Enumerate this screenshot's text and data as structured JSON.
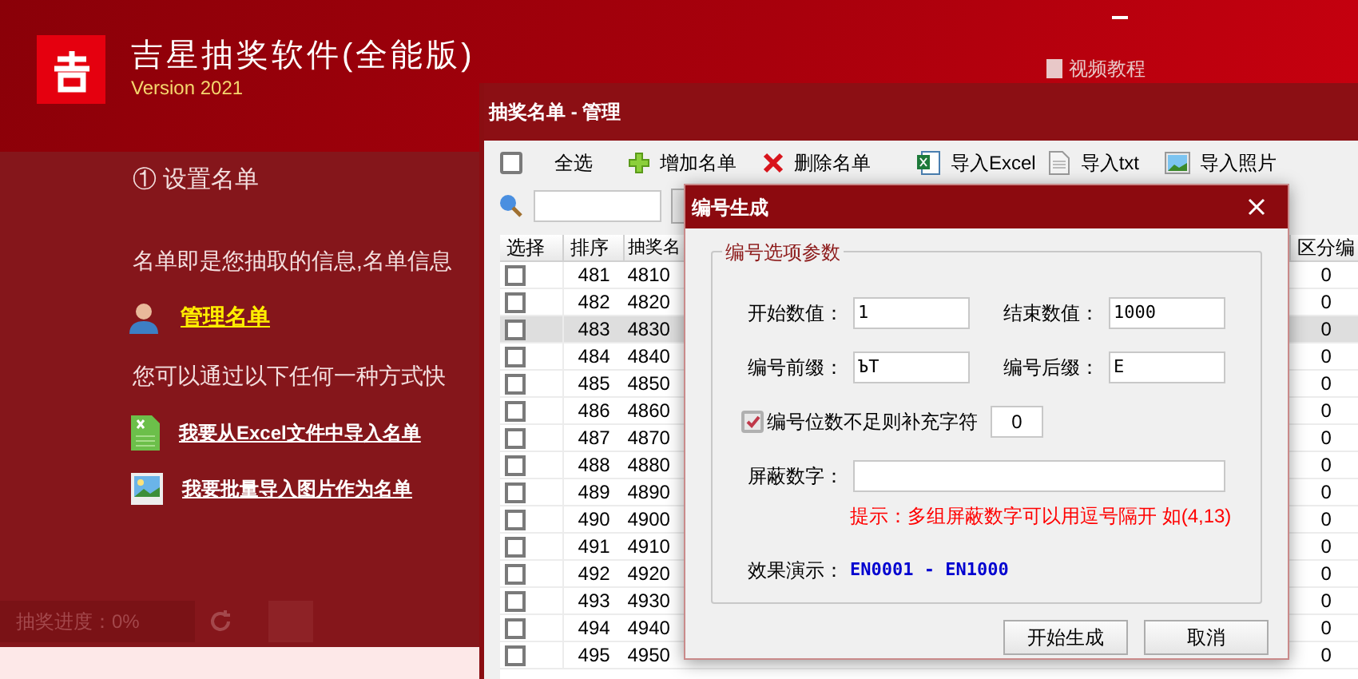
{
  "app": {
    "title": "吉星抽奖软件(全能版)",
    "version": "Version 2021",
    "video_link": "视频教程",
    "section_title": "① 设置名单",
    "description": "名单即是您抽取的信息,名单信息",
    "manage_link": "管理名单",
    "methods_text": "您可以通过以下任何一种方式快",
    "import_links": [
      {
        "kind": "excel",
        "label": "我要从Excel文件中导入名单"
      },
      {
        "kind": "image",
        "label": "我要批量导入图片作为名单"
      }
    ],
    "progress": {
      "text": "抽奖进度：0%",
      "level": 0
    }
  },
  "manager": {
    "title": "抽奖名单 - 管理",
    "select_all": {
      "label": "全选",
      "checked": false
    },
    "toolbar": [
      {
        "kind": "add",
        "label": "增加名单"
      },
      {
        "kind": "delete",
        "label": "删除名单"
      },
      {
        "kind": "excel",
        "label": "导入Excel"
      },
      {
        "kind": "txt",
        "label": "导入txt"
      },
      {
        "kind": "photo",
        "label": "导入照片"
      }
    ],
    "columns": [
      "选择",
      "排序",
      "抽奖名",
      "区分编"
    ],
    "rows": [
      {
        "checked": false,
        "selected": false,
        "order": "481",
        "name": "4810",
        "group": "0"
      },
      {
        "checked": false,
        "selected": false,
        "order": "482",
        "name": "4820",
        "group": "0"
      },
      {
        "checked": false,
        "selected": true,
        "order": "483",
        "name": "4830",
        "group": "0"
      },
      {
        "checked": false,
        "selected": false,
        "order": "484",
        "name": "4840",
        "group": "0"
      },
      {
        "checked": false,
        "selected": false,
        "order": "485",
        "name": "4850",
        "group": "0"
      },
      {
        "checked": false,
        "selected": false,
        "order": "486",
        "name": "4860",
        "group": "0"
      },
      {
        "checked": false,
        "selected": false,
        "order": "487",
        "name": "4870",
        "group": "0"
      },
      {
        "checked": false,
        "selected": false,
        "order": "488",
        "name": "4880",
        "group": "0"
      },
      {
        "checked": false,
        "selected": false,
        "order": "489",
        "name": "4890",
        "group": "0"
      },
      {
        "checked": false,
        "selected": false,
        "order": "490",
        "name": "4900",
        "group": "0"
      },
      {
        "checked": false,
        "selected": false,
        "order": "491",
        "name": "4910",
        "group": "0"
      },
      {
        "checked": false,
        "selected": false,
        "order": "492",
        "name": "4920",
        "group": "0"
      },
      {
        "checked": false,
        "selected": false,
        "order": "493",
        "name": "4930",
        "group": "0"
      },
      {
        "checked": false,
        "selected": false,
        "order": "494",
        "name": "4940",
        "group": "0"
      },
      {
        "checked": false,
        "selected": false,
        "order": "495",
        "name": "4950",
        "group": "0"
      }
    ]
  },
  "dialog": {
    "title": "编号生成",
    "group_title": "编号选项参数",
    "fields": [
      {
        "label": "开始数值：",
        "value": "1"
      },
      {
        "label": "结束数值：",
        "value": "1000"
      },
      {
        "label": "编号前缀：",
        "value": "ЪT"
      },
      {
        "label": "编号后缀：",
        "value": "E"
      }
    ],
    "pad": {
      "label": "编号位数不足则补充字符",
      "checked": true,
      "value": "0"
    },
    "mask": {
      "label": "屏蔽数字："
    },
    "hint": "提示：多组屏蔽数字可以用逗号隔开 如(4,13)",
    "preview": {
      "label": "效果演示：",
      "value": "EN0001 - EN1000"
    },
    "buttons": [
      "开始生成",
      "取消"
    ]
  }
}
